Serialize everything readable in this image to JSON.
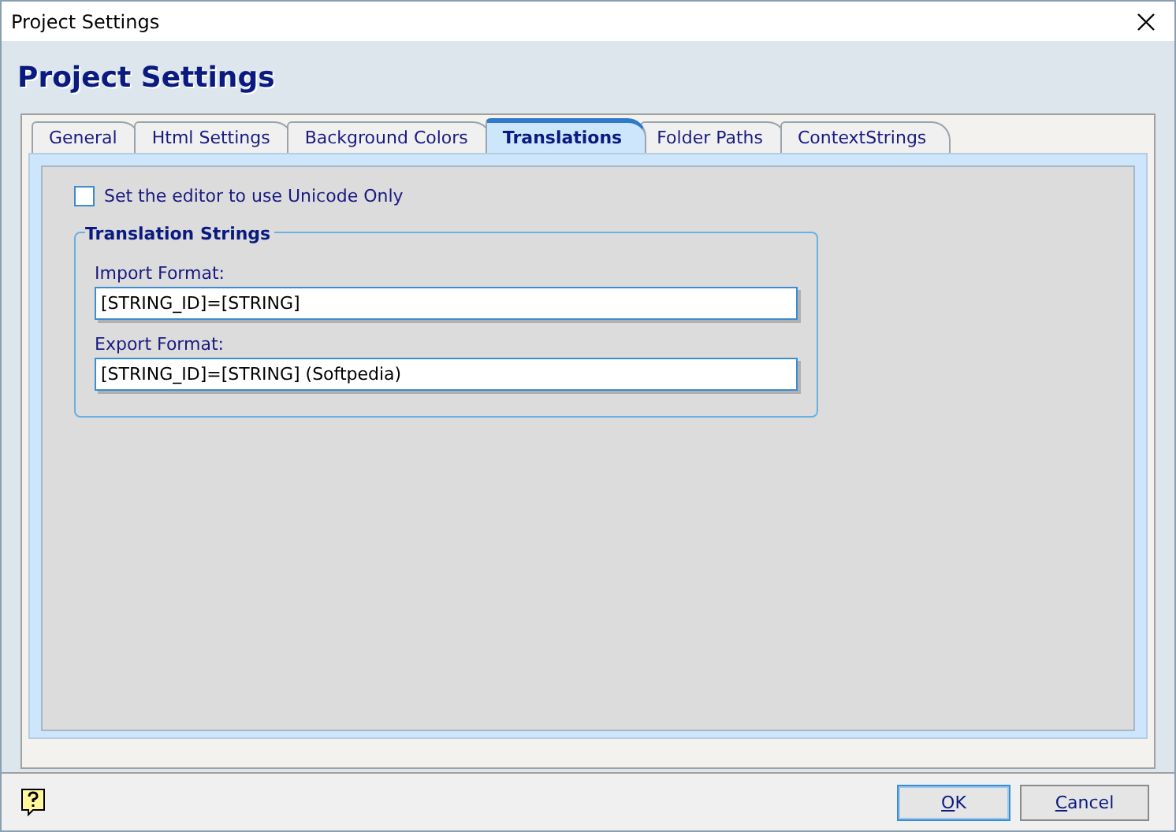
{
  "window": {
    "title": "Project Settings"
  },
  "header": {
    "title": "Project Settings"
  },
  "tabs": [
    {
      "label": "General",
      "selected": false
    },
    {
      "label": "Html Settings",
      "selected": false
    },
    {
      "label": "Background Colors",
      "selected": false
    },
    {
      "label": "Translations",
      "selected": true
    },
    {
      "label": "Folder Paths",
      "selected": false
    },
    {
      "label": "ContextStrings",
      "selected": false
    }
  ],
  "unicode_option": {
    "label": "Set the editor to use Unicode Only",
    "checked": false
  },
  "group": {
    "title": "Translation Strings",
    "fields": [
      {
        "label": "Import Format:",
        "value": "[STRING_ID]=[STRING]"
      },
      {
        "label": "Export Format:",
        "value": "[STRING_ID]=[STRING] (Softpedia)"
      }
    ]
  },
  "buttons": [
    {
      "label": "OK",
      "default": true
    },
    {
      "label": "Cancel",
      "default": false
    }
  ]
}
